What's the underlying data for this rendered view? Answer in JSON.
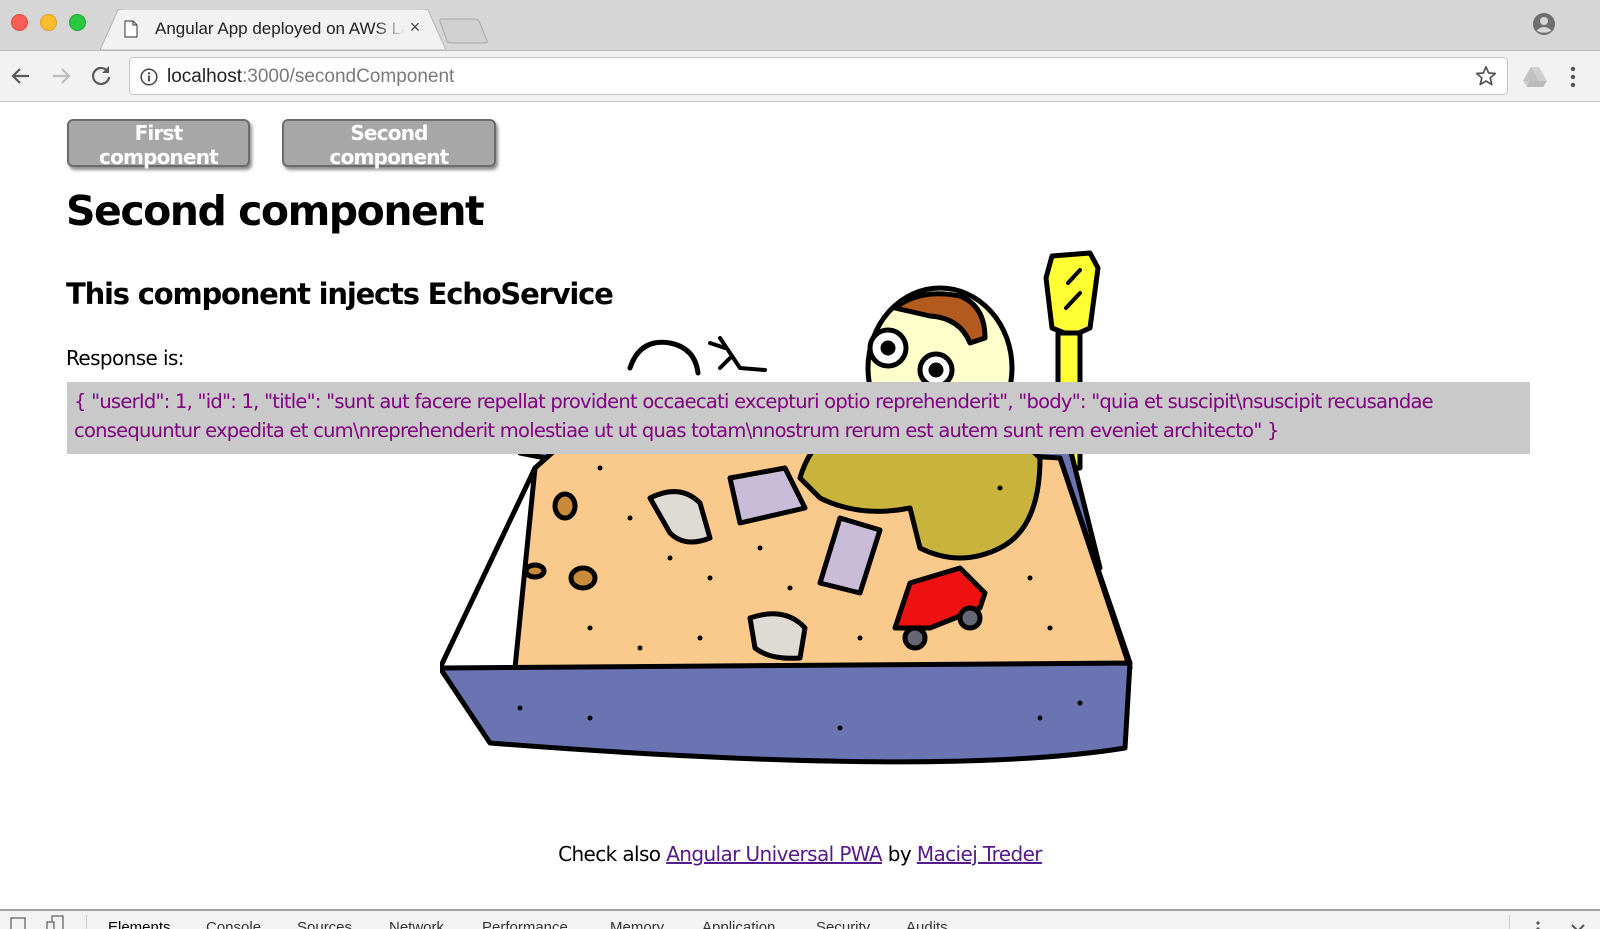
{
  "browser": {
    "tab": {
      "title": "Angular App deployed on AWS Lambda",
      "close_glyph": "×",
      "icon": "document-icon"
    },
    "address_bar": {
      "host": "localhost",
      "rest": ":3000/secondComponent",
      "info_icon": "info-icon"
    },
    "icons": {
      "back": "arrow-left-icon",
      "forward": "arrow-right-icon",
      "reload": "reload-icon",
      "bookmark": "star-icon",
      "extension": "google-drive-icon",
      "menu": "vertical-dots-icon",
      "profile": "profile-icon"
    }
  },
  "page": {
    "nav": {
      "first_label": "First component",
      "second_label": "Second component"
    },
    "heading": "Second component",
    "subheading": "This component injects EchoService",
    "response_label": "Response is:",
    "response_text": "{ \"userId\": 1, \"id\": 1, \"title\": \"sunt aut facere repellat provident occaecati excepturi optio reprehenderit\", \"body\": \"quia et suscipit\\nsuscipit recusandae consequuntur expedita et cum\\nreprehenderit molestiae ut ut quas totam\\nnostrum rerum est autem sunt rem eveniet architecto\" }",
    "illustration": "sandbox-cartoon",
    "footer": {
      "prefix": "Check also ",
      "link1": "Angular Universal PWA",
      "middle": " by ",
      "link2": "Maciej Treder"
    }
  },
  "devtools": {
    "tabs": [
      "Elements",
      "Console",
      "Sources",
      "Network",
      "Performance",
      "Memory",
      "Application",
      "Security",
      "Audits"
    ],
    "active_tab": "Elements"
  },
  "colors": {
    "response_text": "#800080",
    "response_bg": "#c9c9c9",
    "button_bg": "#a7a7a7",
    "link": "#551a8b"
  }
}
